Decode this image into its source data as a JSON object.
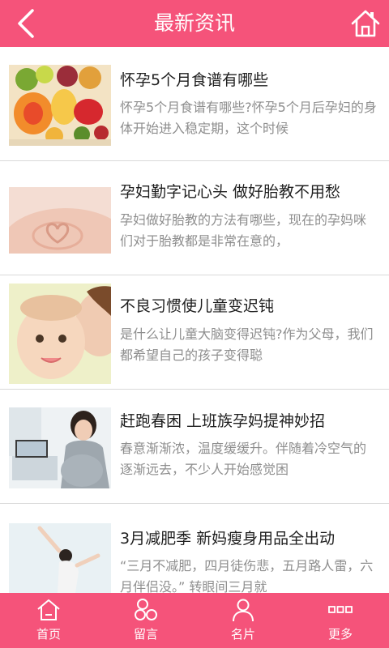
{
  "header": {
    "title": "最新资讯",
    "back_icon": "chevron-left-icon",
    "home_icon": "home-icon"
  },
  "articles": [
    {
      "title": "怀孕5个月食谱有哪些",
      "summary": "怀孕5个月食谱有哪些?怀孕5个月后孕妇的身体开始进入稳定期，这个时候",
      "image": "fruits-and-vegetables-photo"
    },
    {
      "title": "孕妇勤字记心头 做好胎教不用愁",
      "summary": "孕妇做好胎教的方法有哪些，现在的孕妈咪们对于胎教都是非常在意的，",
      "image": "pregnant-belly-heart-hands-photo"
    },
    {
      "title": "不良习惯使儿童变迟钝",
      "summary": "是什么让儿童大脑变得迟钝?作为父母，我们都希望自己的孩子变得聪",
      "image": "mother-and-baby-photo"
    },
    {
      "title": "赶跑春困 上班族孕妈提神妙招",
      "summary": "春意渐渐浓，温度缓缓升。伴随着冷空气的逐渐远去，不少人开始感觉困",
      "image": "pregnant-woman-at-laptop-photo"
    },
    {
      "title": "3月减肥季 新妈瘦身用品全出动",
      "summary": "“三月不减肥，四月徒伤悲，五月路人雷，六月伴侣没。” 转眼间三月就",
      "image": "woman-yoga-stretch-photo"
    }
  ],
  "nav": [
    {
      "label": "首页",
      "icon": "home-icon"
    },
    {
      "label": "留言",
      "icon": "chat-bubbles-icon"
    },
    {
      "label": "名片",
      "icon": "person-card-icon"
    },
    {
      "label": "更多",
      "icon": "more-grid-icon"
    }
  ],
  "colors": {
    "brand": "#f5537a",
    "headline": "#1f1f1f",
    "summary": "#8e8e8e"
  }
}
